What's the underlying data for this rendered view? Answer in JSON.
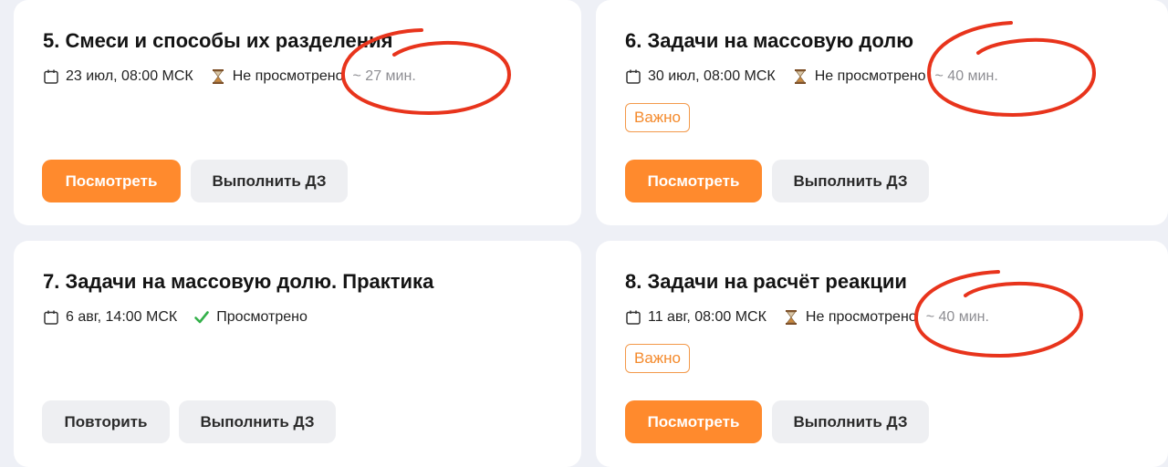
{
  "lessons": [
    {
      "title": "5. Смеси и способы их разделения",
      "date": "23 июл, 08:00 МСК",
      "status": "Не просмотрено",
      "duration": "~ 27 мин.",
      "badge": "",
      "primary_button": "Посмотреть",
      "secondary_button": "Выполнить ДЗ"
    },
    {
      "title": "6. Задачи на массовую долю",
      "date": "30 июл, 08:00 МСК",
      "status": "Не просмотрено",
      "duration": "~ 40 мин.",
      "badge": "Важно",
      "primary_button": "Посмотреть",
      "secondary_button": "Выполнить ДЗ"
    },
    {
      "title": "7. Задачи на массовую долю. Практика",
      "date": "6 авг, 14:00 МСК",
      "status": "Просмотрено",
      "duration": "",
      "badge": "",
      "primary_button": "Повторить",
      "secondary_button": "Выполнить ДЗ"
    },
    {
      "title": "8. Задачи на расчёт реакции",
      "date": "11 авг, 08:00 МСК",
      "status": "Не просмотрено",
      "duration": "~ 40 мин.",
      "badge": "Важно",
      "primary_button": "Посмотреть",
      "secondary_button": "Выполнить ДЗ"
    }
  ],
  "icons": {
    "date": "calendar-icon",
    "unwatched": "hourglass-icon",
    "watched": "checkmark-icon"
  },
  "colors": {
    "accent": "#ff8a2d",
    "badge": "#f48a2c",
    "watched_check": "#34b04a",
    "annotation": "#e8341c"
  }
}
